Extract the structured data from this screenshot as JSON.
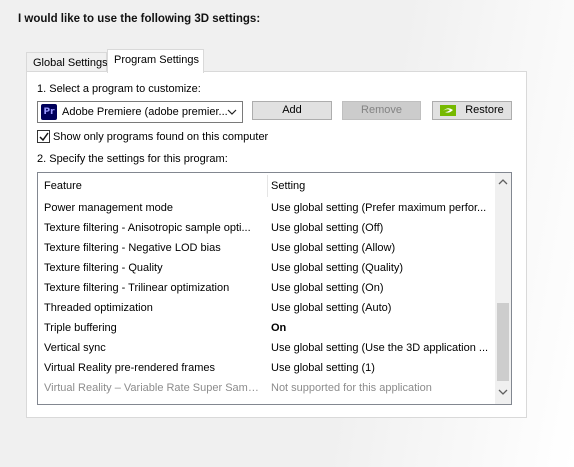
{
  "heading": "I would like to use the following 3D settings:",
  "tabs": [
    {
      "label": "Global Settings",
      "active": false
    },
    {
      "label": "Program Settings",
      "active": true
    }
  ],
  "program": {
    "select_label": "1. Select a program to customize:",
    "selected_program": "Adobe Premiere (adobe premier...",
    "program_icon_text": "Pr",
    "add_label": "Add",
    "remove_label": "Remove",
    "restore_label": "Restore",
    "show_only_label": "Show only programs found on this computer",
    "show_only_checked": true,
    "specify_label": "2. Specify the settings for this program:"
  },
  "grid": {
    "columns": [
      "Feature",
      "Setting"
    ],
    "rows": [
      {
        "feature": "Power management mode",
        "setting": "Use global setting (Prefer maximum perfor...",
        "bold": false,
        "disabled": false
      },
      {
        "feature": "Texture filtering - Anisotropic sample opti...",
        "setting": "Use global setting (Off)",
        "bold": false,
        "disabled": false
      },
      {
        "feature": "Texture filtering - Negative LOD bias",
        "setting": "Use global setting (Allow)",
        "bold": false,
        "disabled": false
      },
      {
        "feature": "Texture filtering - Quality",
        "setting": "Use global setting (Quality)",
        "bold": false,
        "disabled": false
      },
      {
        "feature": "Texture filtering - Trilinear optimization",
        "setting": "Use global setting (On)",
        "bold": false,
        "disabled": false
      },
      {
        "feature": "Threaded optimization",
        "setting": "Use global setting (Auto)",
        "bold": false,
        "disabled": false
      },
      {
        "feature": "Triple buffering",
        "setting": "On",
        "bold": true,
        "disabled": false
      },
      {
        "feature": "Vertical sync",
        "setting": "Use global setting (Use the 3D application ...",
        "bold": false,
        "disabled": false
      },
      {
        "feature": "Virtual Reality pre-rendered frames",
        "setting": "Use global setting (1)",
        "bold": false,
        "disabled": false
      },
      {
        "feature": "Virtual Reality – Variable Rate Super Samp...",
        "setting": "Not supported for this application",
        "bold": false,
        "disabled": true
      }
    ]
  },
  "colors": {
    "nvidia_green": "#76b900",
    "premiere_bg": "#00005b",
    "premiere_fg": "#9999ff"
  }
}
